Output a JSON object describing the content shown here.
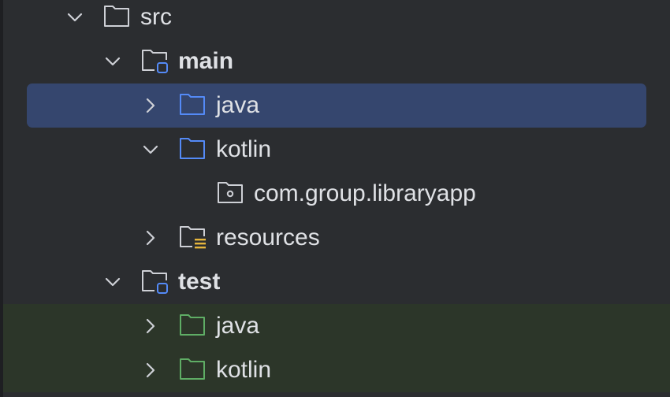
{
  "tree": {
    "rows": [
      {
        "label": "src",
        "expanded": true,
        "icon": "folder-icon"
      },
      {
        "label": "main",
        "expanded": true,
        "icon": "module-folder-icon"
      },
      {
        "label": "java",
        "expanded": false,
        "icon": "source-root-folder-icon",
        "selected": true
      },
      {
        "label": "kotlin",
        "expanded": true,
        "icon": "source-root-folder-icon"
      },
      {
        "label": "com.group.libraryapp",
        "icon": "package-folder-icon"
      },
      {
        "label": "resources",
        "expanded": false,
        "icon": "resources-folder-icon"
      },
      {
        "label": "test",
        "expanded": true,
        "icon": "module-folder-icon"
      },
      {
        "label": "java",
        "expanded": false,
        "icon": "test-root-folder-icon"
      },
      {
        "label": "kotlin",
        "expanded": false,
        "icon": "test-root-folder-icon"
      }
    ]
  },
  "colors": {
    "background": "#2b2d30",
    "selection": "#35466e",
    "test_background": "#2c3629",
    "text": "#dfe1e5",
    "source_folder": "#548af7",
    "test_folder": "#5fad65",
    "plain_folder": "#ced0d6",
    "resources_badge": "#e6b63d"
  }
}
